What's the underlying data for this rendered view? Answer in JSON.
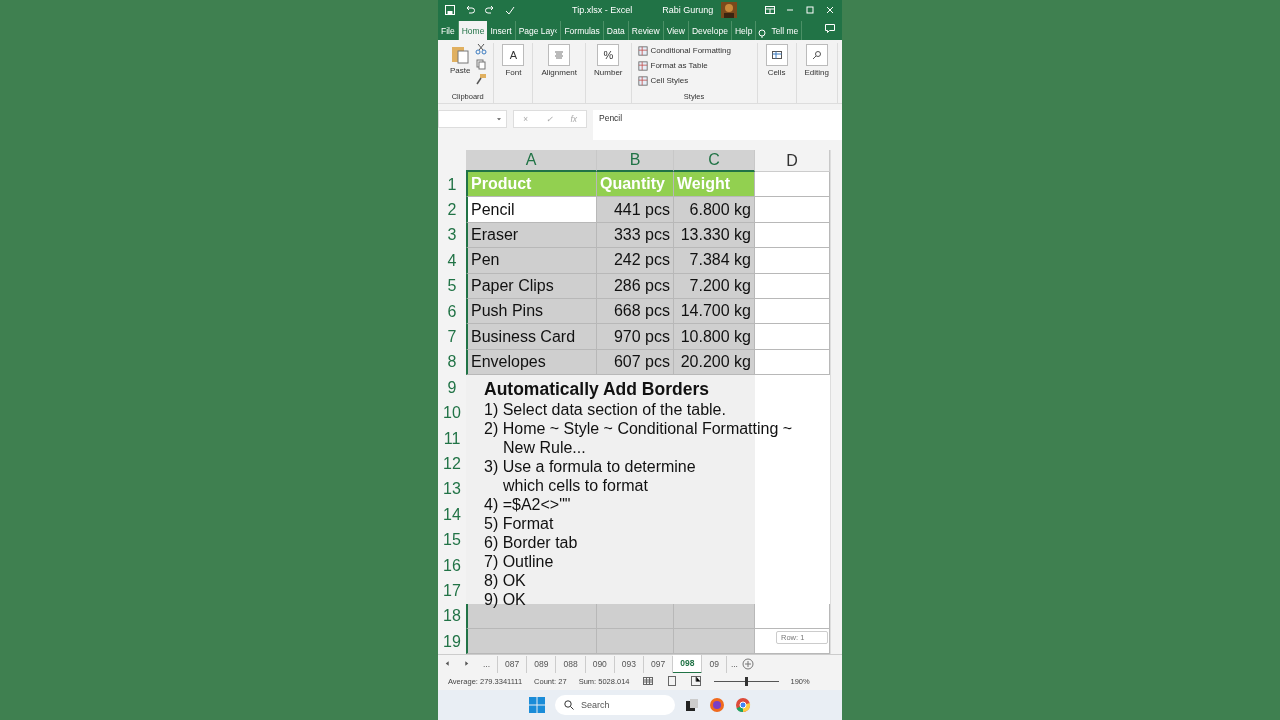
{
  "title_bar": {
    "file": "Tip.xlsx",
    "separator": "-",
    "app": "Excel",
    "user": "Rabi Gurung"
  },
  "tabs": [
    {
      "label": "File",
      "selected": false
    },
    {
      "label": "Home",
      "selected": true
    },
    {
      "label": "Insert",
      "selected": false
    },
    {
      "label": "Page Lay‹",
      "selected": false
    },
    {
      "label": "Formulas",
      "selected": false
    },
    {
      "label": "Data",
      "selected": false
    },
    {
      "label": "Review",
      "selected": false
    },
    {
      "label": "View",
      "selected": false
    },
    {
      "label": "Develope",
      "selected": false
    },
    {
      "label": "Help",
      "selected": false
    }
  ],
  "tell_me": "Tell me",
  "ribbon": {
    "groups": [
      {
        "kind": "clipboard",
        "button": "Paste",
        "label": "Clipboard"
      },
      {
        "kind": "button",
        "button": "Font",
        "glyph": "A"
      },
      {
        "kind": "button",
        "button": "Alignment"
      },
      {
        "kind": "button",
        "button": "Number",
        "glyph": "%"
      },
      {
        "kind": "list",
        "items": [
          "Conditional Formatting",
          "Format as Table",
          "Cell Styles"
        ],
        "label": "Styles"
      },
      {
        "kind": "button",
        "button": "Cells"
      },
      {
        "kind": "button",
        "button": "Editing"
      }
    ]
  },
  "formula_bar": {
    "buttons": [
      "×",
      "✓",
      "fx"
    ],
    "value": "Pencil"
  },
  "columns": [
    "A",
    "B",
    "C",
    "D"
  ],
  "rows": [
    {
      "number": "1",
      "kind": "header",
      "cells": [
        "Product",
        "Quantity",
        "Weight"
      ]
    },
    {
      "number": "2",
      "kind": "data",
      "cells": [
        "Pencil",
        "441 pcs",
        "6.800 kg"
      ],
      "active": true
    },
    {
      "number": "3",
      "kind": "data",
      "cells": [
        "Eraser",
        "333 pcs",
        "13.330 kg"
      ],
      "active": false
    },
    {
      "number": "4",
      "kind": "data",
      "cells": [
        "Pen",
        "242 pcs",
        "7.384 kg"
      ],
      "active": false
    },
    {
      "number": "5",
      "kind": "data",
      "cells": [
        "Paper Clips",
        "286 pcs",
        "7.200 kg"
      ],
      "active": false
    },
    {
      "number": "6",
      "kind": "data",
      "cells": [
        "Push Pins",
        "668 pcs",
        "14.700 kg"
      ],
      "active": false
    },
    {
      "number": "7",
      "kind": "data",
      "cells": [
        "Business Card",
        "970 pcs",
        "10.800 kg"
      ],
      "active": false
    },
    {
      "number": "8",
      "kind": "data",
      "cells": [
        "Envelopes",
        "607 pcs",
        "20.200 kg"
      ],
      "active": false
    },
    {
      "number": "9",
      "kind": "empty"
    },
    {
      "number": "10",
      "kind": "empty"
    },
    {
      "number": "11",
      "kind": "empty"
    },
    {
      "number": "12",
      "kind": "empty"
    },
    {
      "number": "13",
      "kind": "empty"
    },
    {
      "number": "14",
      "kind": "empty"
    },
    {
      "number": "15",
      "kind": "empty"
    },
    {
      "number": "16",
      "kind": "empty"
    },
    {
      "number": "17",
      "kind": "empty"
    },
    {
      "number": "18",
      "kind": "empty"
    },
    {
      "number": "19",
      "kind": "empty"
    }
  ],
  "note": {
    "title": "Automatically Add Borders",
    "steps": [
      {
        "lines": [
          "1) Select data section of the table."
        ]
      },
      {
        "lines": [
          "2) Home ~ Style ~ Conditional Formatting ~",
          "New Rule..."
        ]
      },
      {
        "lines": [
          "3) Use a formula to determine",
          "which cells to format"
        ]
      },
      {
        "lines": [
          "4) =$A2<>\"\""
        ]
      },
      {
        "lines": [
          "5) Format"
        ]
      },
      {
        "lines": [
          "6) Border tab"
        ]
      },
      {
        "lines": [
          "7) Outline"
        ]
      },
      {
        "lines": [
          "8) OK"
        ]
      },
      {
        "lines": [
          "9) OK"
        ]
      }
    ]
  },
  "row_tooltip": "Row: 1",
  "sheets": {
    "overflow_left": "...",
    "overflow_right": "...",
    "tabs": [
      {
        "label": "087",
        "selected": false
      },
      {
        "label": "089",
        "selected": false
      },
      {
        "label": "088",
        "selected": false
      },
      {
        "label": "090",
        "selected": false
      },
      {
        "label": "093",
        "selected": false
      },
      {
        "label": "097",
        "selected": false
      },
      {
        "label": "098",
        "selected": true
      },
      {
        "label": "09",
        "selected": false
      }
    ]
  },
  "status_bar": {
    "average": "Average: 279.3341111",
    "count": "Count: 27",
    "sum": "Sum: 5028.014",
    "zoom": {
      "level": 0.5,
      "reading": "190%"
    }
  },
  "taskbar": {
    "search": {
      "placeholder": "Search"
    }
  }
}
